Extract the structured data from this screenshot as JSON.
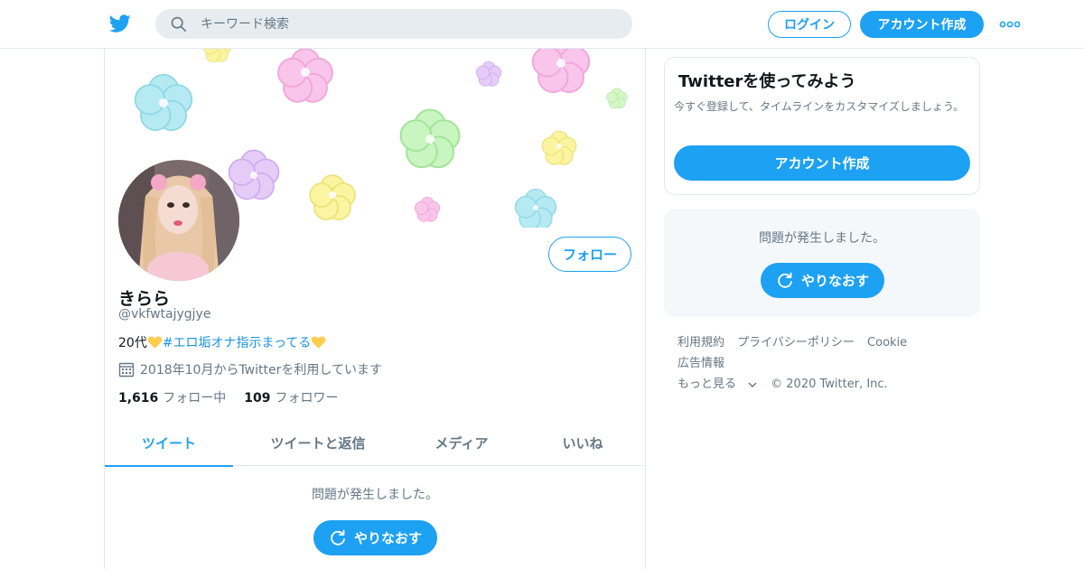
{
  "header": {
    "logo_icon": "twitter-bird-icon",
    "search_placeholder": "キーワード検索",
    "login_label": "ログイン",
    "signup_label": "アカウント作成",
    "more_icon": "more-dots-icon"
  },
  "profile": {
    "name": "きらら",
    "handle": "@vkfwtajygjye",
    "bio_prefix": "20代",
    "bio_hashtag": "#エロ垢オナ指示まってる",
    "joined": "2018年10月からTwitterを利用しています",
    "following_count": "1,616",
    "following_label": "フォロー中",
    "followers_count": "109",
    "followers_label": "フォロワー",
    "follow_label": "フォロー"
  },
  "tabs": [
    {
      "label": "ツイート",
      "active": true
    },
    {
      "label": "ツイートと返信",
      "active": false
    },
    {
      "label": "メディア",
      "active": false
    },
    {
      "label": "いいね",
      "active": false
    }
  ],
  "timeline_error": {
    "message": "問題が発生しました。",
    "retry_label": "やりなおす"
  },
  "signup_card": {
    "title": "Twitterを使ってみよう",
    "description": "今すぐ登録して、タイムラインをカスタマイズしましょう。",
    "button_label": "アカウント作成"
  },
  "sidebar_error": {
    "message": "問題が発生しました。",
    "retry_label": "やりなおす"
  },
  "footer": {
    "links": [
      "利用規約",
      "プライバシーポリシー",
      "Cookie",
      "広告情報"
    ],
    "more_label": "もっと見る",
    "copyright": "© 2020 Twitter, Inc."
  },
  "colors": {
    "accent": "#1da1f2",
    "hashtag": "#1b95e0",
    "muted": "#657786",
    "border": "#e1e8ed"
  }
}
